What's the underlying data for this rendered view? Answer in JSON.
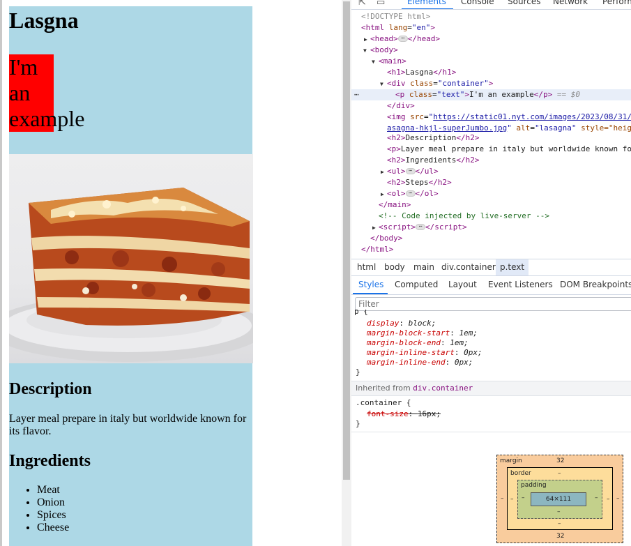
{
  "page": {
    "heading": "Lasgna",
    "red_lines": [
      "I'm",
      "an",
      "example"
    ],
    "image_alt": "lasagna",
    "description_heading": "Description",
    "description_text": "Layer meal prepare in italy but worldwide known for its flavor.",
    "ingredients_heading": "Ingredients",
    "ingredients": [
      "Meat",
      "Onion",
      "Spices",
      "Cheese"
    ],
    "colors": {
      "main_bg": "#add8e6",
      "red_box": "#ff0000"
    }
  },
  "devtools": {
    "toolbar": {
      "icons": [
        "inspect-icon",
        "device-toolbar-icon"
      ],
      "tabs": [
        "Elements",
        "Console",
        "Sources",
        "Network",
        "Perform"
      ],
      "active_tab": "Elements"
    },
    "dom": {
      "doctype": "<!DOCTYPE html>",
      "html_open": "html",
      "lang_attr": "lang",
      "lang_val": "\"en\"",
      "head": "head",
      "body": "body",
      "main": "main",
      "h1_text": "Lasgna",
      "div_class": "\"container\"",
      "p_class": "\"text\"",
      "p_text": "I'm an example",
      "selected_suffix": "== $0",
      "img_src_1": "https://static01.nyt.com/images/2023/08/31/",
      "img_src_2": "asagna-hkjl-superJumbo.jpg",
      "img_alt": "\"lasagna\"",
      "img_style": "style=\"heig",
      "h2_desc": "Description",
      "p_desc": "Layer meal prepare in italy but worldwide known fo",
      "h2_ing": "Ingredients",
      "h2_steps": "Steps",
      "comment": "<!-- Code injected by live-server -->",
      "script": "script"
    },
    "breadcrumbs": [
      "html",
      "body",
      "main",
      "div.container",
      "p.text"
    ],
    "sub_tabs": [
      "Styles",
      "Computed",
      "Layout",
      "Event Listeners",
      "DOM Breakpoints"
    ],
    "filter_placeholder": "Filter",
    "ua_rule": {
      "selector_fragment": "p {",
      "declarations": [
        {
          "prop": "display",
          "value": "block;"
        },
        {
          "prop": "margin-block-start",
          "value": "1em;"
        },
        {
          "prop": "margin-block-end",
          "value": "1em;"
        },
        {
          "prop": "margin-inline-start",
          "value": "0px;"
        },
        {
          "prop": "margin-inline-end",
          "value": "0px;"
        }
      ],
      "close": "}"
    },
    "inherited": {
      "label": "Inherited from",
      "source": "div.container"
    },
    "container_rule": {
      "selector": ".container {",
      "prop": "font-size",
      "value": "16px;",
      "close": "}"
    },
    "box_model": {
      "margin_label": "margin",
      "margin_top": "32",
      "margin_bottom": "32",
      "margin_left": "–",
      "margin_right": "–",
      "border_label": "border",
      "border_value": "–",
      "padding_label": "padding",
      "padding_value": "–",
      "content": "64×111"
    }
  }
}
